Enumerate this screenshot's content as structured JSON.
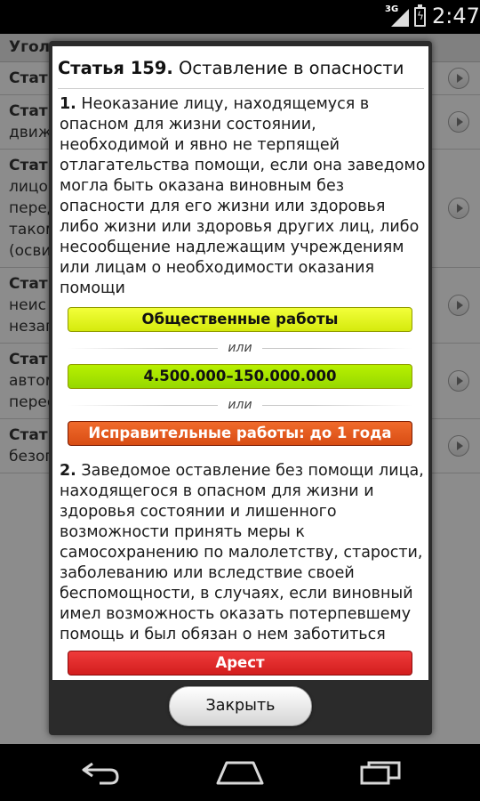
{
  "status_bar": {
    "network": "3G",
    "time": "2:47"
  },
  "background_list": {
    "header": "Уголо",
    "rows": [
      {
        "title": "Стать",
        "lines": []
      },
      {
        "title": "Стать",
        "lines": [
          "движ"
        ]
      },
      {
        "title": "Стать",
        "lines": [
          "лицо",
          "перед",
          "таком",
          "(осви"
        ]
      },
      {
        "title": "Стать",
        "lines": [
          "неис",
          "незап"
        ]
      },
      {
        "title": "Стать",
        "lines": [
          "автом",
          "перес"
        ]
      },
      {
        "title": "Стать",
        "lines": [
          "безоп"
        ]
      }
    ]
  },
  "dialog": {
    "title_number": "Статья 159.",
    "title_text": "Оставление в опасности",
    "paragraph1_number": "1.",
    "paragraph1_text": "Неоказание лицу, находящемуся в опасном для жизни состоянии, необходимой и явно не терпящей отлагательства помощи, если она заведомо могла быть оказана виновным без опасности для его жизни или здоровья либо жизни или здоровья других лиц, либо несообщение надлежащим учреждениям или лицам о необходимости оказания помощи",
    "penalty1": "Общественные работы",
    "or1": "или",
    "penalty2": "4.500.000–150.000.000",
    "or2": "или",
    "penalty3": "Исправительные работы: до 1 года",
    "paragraph2_number": "2.",
    "paragraph2_text": "Заведомое оставление без помощи лица, находящегося в опасном для жизни и здоровья состоянии и лишенного возможности принять меры к самосохранению по малолетству, старости, заболеванию или вследствие своей беспомощности, в случаях, если виновный имел возможность оказать потерпевшему помощь и был обязан о нем заботиться",
    "penalty4": "Арест",
    "close_label": "Закрыть"
  },
  "navigation": {
    "back": "back-icon",
    "home": "home-icon",
    "recent": "recent-apps-icon"
  }
}
